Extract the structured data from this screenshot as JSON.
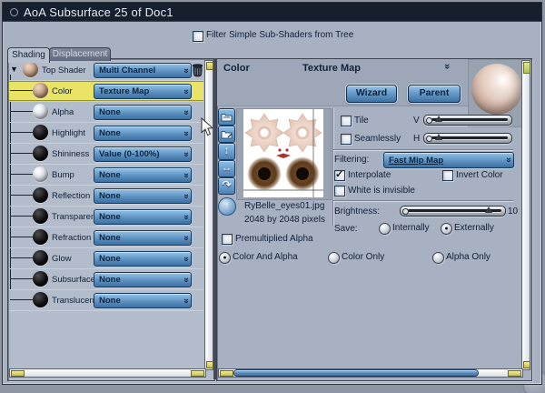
{
  "window": {
    "title": "AoA  Subsurface 25 of Doc1"
  },
  "toolbar": {
    "filter_label": "Filter Simple Sub-Shaders from Tree",
    "filter_mark": ""
  },
  "tabs": {
    "shading": "Shading",
    "displacement": "Displacement",
    "active": "Shading"
  },
  "tree": {
    "root": {
      "label": "Top Shader",
      "value": "Multi Channel",
      "sphere": "tan"
    },
    "channels": [
      {
        "label": "Color",
        "value": "Texture Map",
        "sphere": "tan",
        "selected": true
      },
      {
        "label": "Alpha",
        "value": "None",
        "sphere": "white"
      },
      {
        "label": "Highlight",
        "value": "None",
        "sphere": "black"
      },
      {
        "label": "Shininess",
        "value": "Value (0-100%)",
        "sphere": "black"
      },
      {
        "label": "Bump",
        "value": "None",
        "sphere": "white"
      },
      {
        "label": "Reflection",
        "value": "None",
        "sphere": "black"
      },
      {
        "label": "Transparency",
        "value": "None",
        "sphere": "black"
      },
      {
        "label": "Refraction",
        "value": "None",
        "sphere": "black"
      },
      {
        "label": "Glow",
        "value": "None",
        "sphere": "black"
      },
      {
        "label": "Subsurface Sc",
        "value": "None",
        "sphere": "black"
      },
      {
        "label": "Translucency",
        "value": "None",
        "sphere": "black"
      }
    ]
  },
  "detail": {
    "channel": "Color",
    "shader_type": "Texture Map",
    "wizard": "Wizard",
    "parent": "Parent",
    "texture": {
      "filename": "RyBelle_eyes01.jpg",
      "dimensions": "2048 by 2048 pixels"
    },
    "tile": {
      "label": "Tile",
      "mark": ""
    },
    "seamlessly": {
      "label": "Seamlessly",
      "mark": ""
    },
    "v_label": "V",
    "h_label": "H",
    "filtering_label": "Filtering:",
    "filtering_value": "Fast Mip Map",
    "interpolate": {
      "label": "Interpolate",
      "mark": "✓"
    },
    "invert_color": {
      "label": "Invert Color",
      "mark": ""
    },
    "white_invisible": {
      "label": "White is invisible",
      "mark": ""
    },
    "brightness_label": "Brightness:",
    "brightness_value": "10",
    "premultiplied": {
      "label": "Premultiplied Alpha",
      "mark": ""
    },
    "save_label": "Save:",
    "save_options": {
      "internally": {
        "label": "Internally",
        "mark": ""
      },
      "externally": {
        "label": "Externally",
        "mark": "●"
      }
    },
    "alpha_mode": {
      "color_and_alpha": {
        "label": "Color And Alpha",
        "mark": "●"
      },
      "color_only": {
        "label": "Color Only",
        "mark": ""
      },
      "alpha_only": {
        "label": "Alpha Only",
        "mark": ""
      }
    }
  },
  "icons": {
    "expander": "▼",
    "chevron_down": "»",
    "flip_vertical": "↕",
    "flip_horizontal": "↔",
    "rotate": "↷",
    "up_arrow": "↑"
  },
  "colors": {
    "accent_blue": "#4f7fb0",
    "highlight_yellow": "#eae466",
    "titlebar": "#151f2d"
  }
}
